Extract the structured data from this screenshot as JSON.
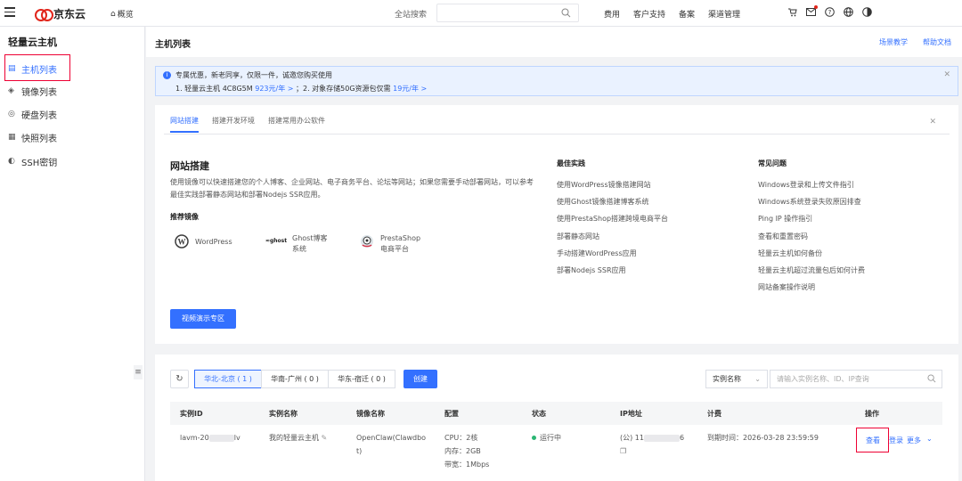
{
  "topbar": {
    "logo_text": "京东云",
    "overview": "概览",
    "search_label": "全站搜索",
    "links": [
      "费用",
      "客户支持",
      "备案",
      "渠道管理"
    ]
  },
  "sidebar": {
    "title": "轻量云主机",
    "items": [
      {
        "label": "主机列表",
        "icon": "document-icon",
        "active": true
      },
      {
        "label": "镜像列表",
        "icon": "layers-icon"
      },
      {
        "label": "硬盘列表",
        "icon": "disk-icon"
      },
      {
        "label": "快照列表",
        "icon": "snapshot-icon"
      },
      {
        "label": "SSH密钥",
        "icon": "key-icon"
      }
    ]
  },
  "header": {
    "title": "主机列表",
    "links": [
      "场景教学",
      "帮助文档"
    ]
  },
  "notice": {
    "line1": "专属优惠，新老同享，仅限一件，诚邀您购买使用",
    "line2_a": "1. 轻量云主机 4C8G5M",
    "line2_link1": "923元/年 >",
    "line2_b": "；2. 对象存储50G资源包仅需",
    "line2_link2": "19元/年 >"
  },
  "guide": {
    "tabs": [
      "网站搭建",
      "搭建开发环境",
      "搭建常用办公软件"
    ],
    "title": "网站搭建",
    "desc": "使用镜像可以快速搭建您的个人博客、企业网站、电子商务平台、论坛等网站；如果您需要手动部署网站，可以参考最佳实践部署静态网站和部署Nodejs SSR应用。",
    "rec_label": "推荐镜像",
    "mirrors": [
      {
        "name": "WordPress",
        "icon": "wordpress-icon"
      },
      {
        "name": "Ghost博客系统",
        "icon": "ghost-icon"
      },
      {
        "name": "PrestaShop电商平台",
        "icon": "prestashop-icon"
      }
    ],
    "best_title": "最佳实践",
    "best": [
      "使用WordPress镜像搭建网站",
      "使用Ghost镜像搭建博客系统",
      "使用PrestaShop搭建跨境电商平台",
      "部署静态网站",
      "手动搭建WordPress应用",
      "部署Nodejs SSR应用"
    ],
    "faq_title": "常见问题",
    "faq": [
      "Windows登录和上传文件指引",
      "Windows系统登录失败原因排查",
      "Ping IP 操作指引",
      "查看和重置密码",
      "轻量云主机如何备份",
      "轻量云主机超过流量包后如何计费",
      "网站备案操作说明"
    ],
    "video_button": "视频演示专区"
  },
  "instances": {
    "regions": [
      "华北-北京 ( 1 )",
      "华南-广州 ( 0 )",
      "华东-宿迁 ( 0 )"
    ],
    "create_button": "创建",
    "filter_select": "实例名称",
    "filter_placeholder": "请输入实例名称、ID、IP查询",
    "columns": [
      "实例ID",
      "实例名称",
      "镜像名称",
      "配置",
      "状态",
      "IP地址",
      "计费",
      "操作"
    ],
    "row": {
      "id_prefix": "lavm-20",
      "id_suffix": "lv",
      "name": "我的轻量云主机",
      "image_line1": "OpenClaw(Clawdbo",
      "image_line2": "t)",
      "cpu": "CPU：2核",
      "mem": "内存：2GB",
      "bw": "带宽：1Mbps",
      "status": "运行中",
      "ip_prefix": "(公) 11",
      "ip_suffix": "6",
      "billing": "到期时间：2026-03-28 23:59:59",
      "ops": [
        "查看",
        "登录",
        "更多"
      ]
    }
  },
  "colors": {
    "accent": "#3370ff",
    "brand": "#e1251b",
    "running": "#2bb673",
    "highlight": "#ee0033"
  }
}
